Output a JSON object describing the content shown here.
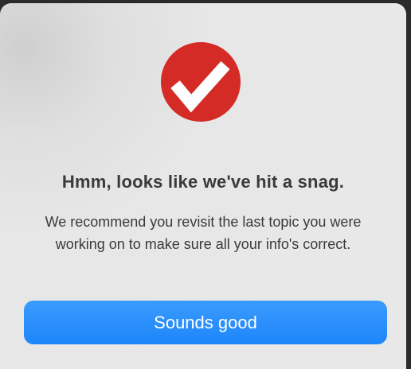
{
  "dialog": {
    "logo_icon": "red-circle-checkmark-icon",
    "logo_color": "#d52b27",
    "title": "Hmm, looks like we've hit a snag.",
    "message": "We recommend you revisit the last topic you were working on to make sure all your info's correct.",
    "primary_button_label": "Sounds good",
    "primary_button_color": "#1e86fa"
  }
}
